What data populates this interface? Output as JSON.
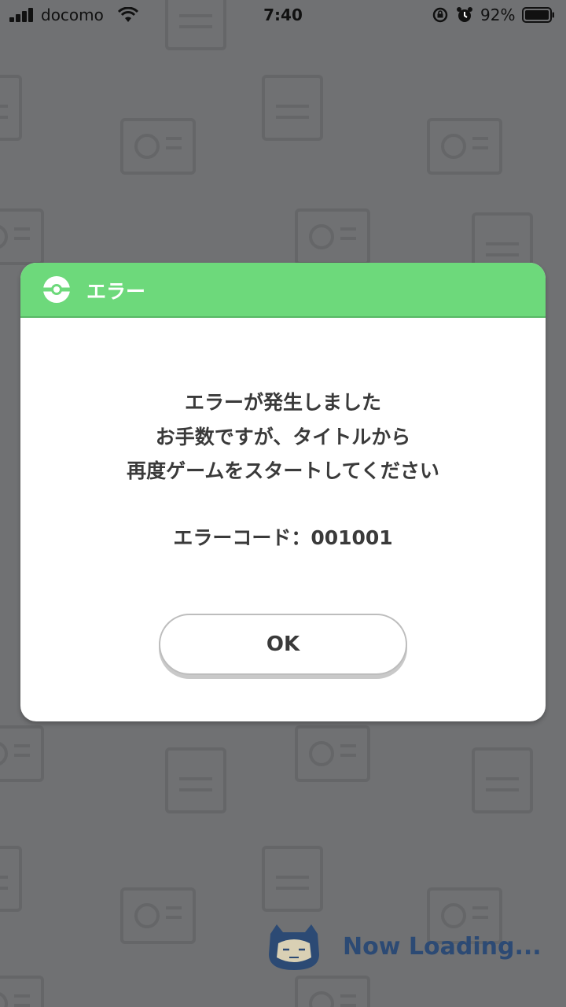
{
  "status_bar": {
    "carrier": "docomo",
    "time": "7:40",
    "battery_percent": "92%",
    "icons": [
      "signal-icon",
      "wifi-icon",
      "rotation-lock-icon",
      "alarm-icon",
      "battery-icon"
    ]
  },
  "dialog": {
    "title": "エラー",
    "header_icon": "pokeball-icon",
    "message_lines": [
      "エラーが発生しました",
      "お手数ですが、タイトルから",
      "再度ゲームをスタートしてください"
    ],
    "error_code": "エラーコード：001001",
    "ok_label": "OK"
  },
  "loading": {
    "text": "Now Loading...",
    "icon": "snorlax-icon"
  },
  "colors": {
    "header_green": "#6dd97b",
    "overlay_gray": "#707173",
    "loading_blue": "#2c4a74",
    "text_dark": "#3a3a3a"
  }
}
